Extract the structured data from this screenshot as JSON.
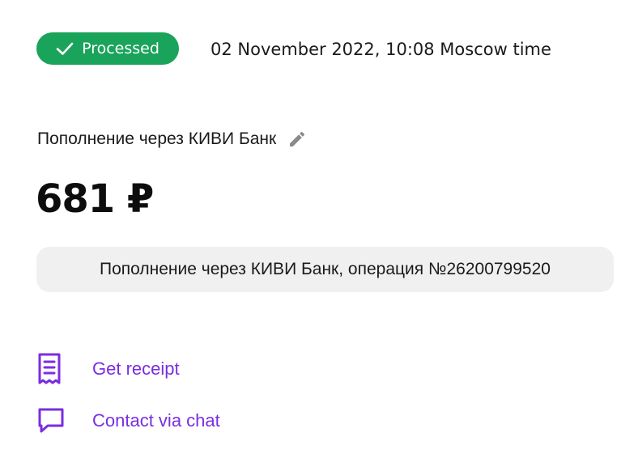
{
  "status": {
    "label": "Processed",
    "color": "#1aa35a",
    "icon": "check-icon"
  },
  "timestamp": "02 November 2022, 10:08 Moscow time",
  "payment": {
    "title": "Пополнение через КИВИ Банк",
    "amount": "681 ₽",
    "comment": "Пополнение через КИВИ Банк, операция №26200799520",
    "edit_icon": "pencil-icon"
  },
  "actions": [
    {
      "label": "Get receipt",
      "icon": "receipt-icon"
    },
    {
      "label": "Contact via chat",
      "icon": "chat-icon"
    }
  ],
  "colors": {
    "accent": "#7a2ee0",
    "comment_background": "#f0f0f0"
  }
}
